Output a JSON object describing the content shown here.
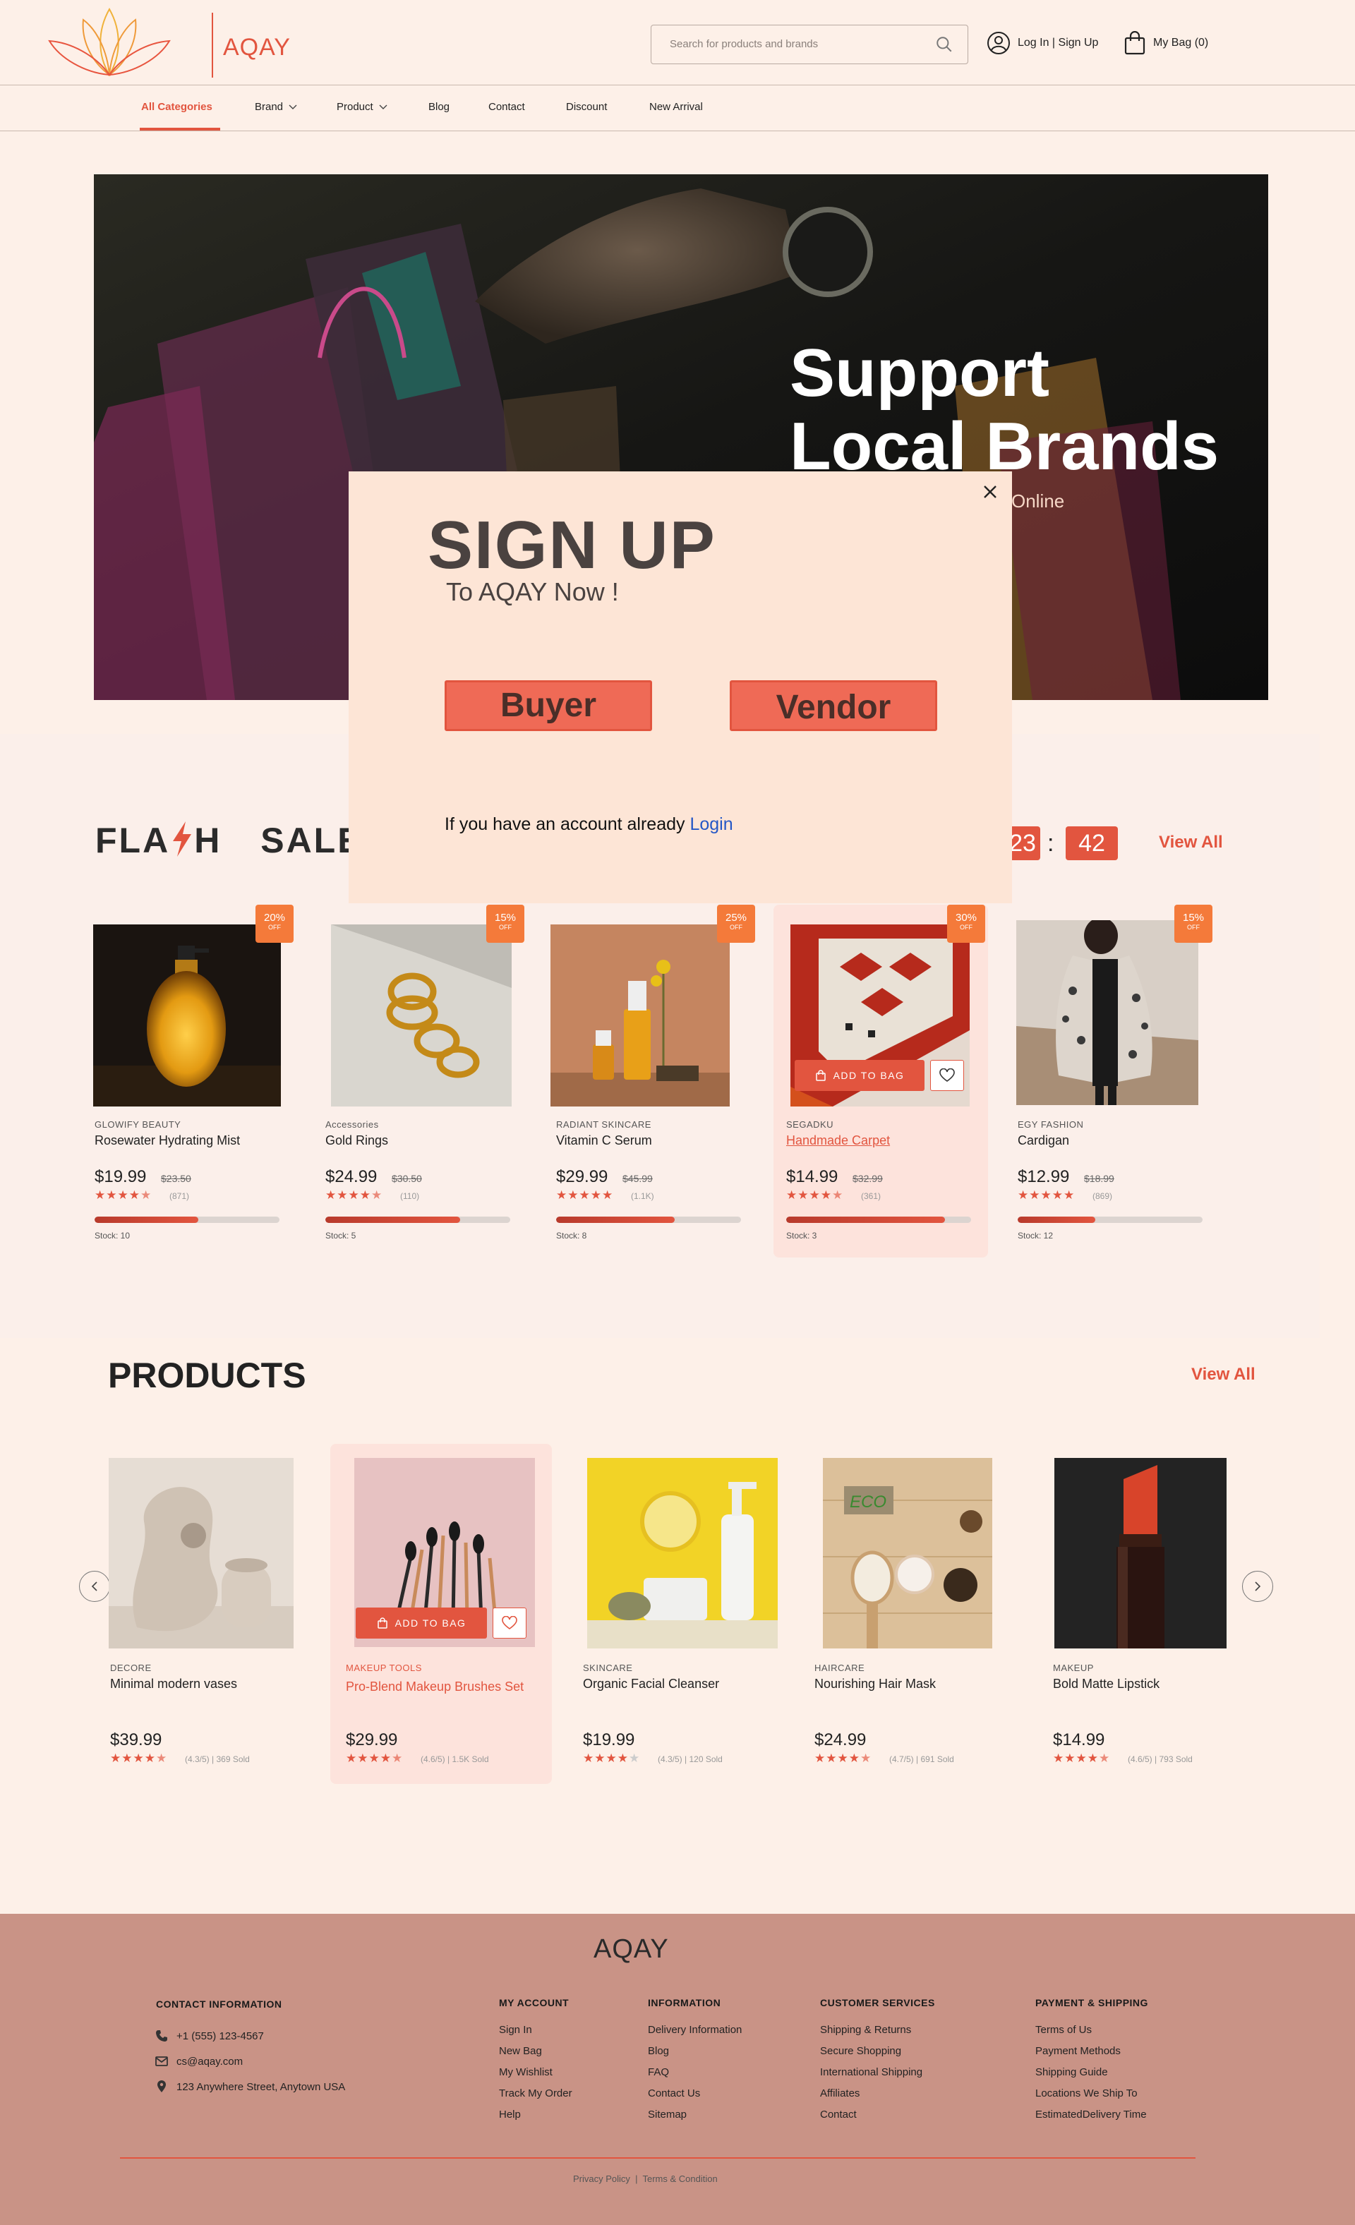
{
  "brand": {
    "name": "AQAY",
    "accent": "#e2553f"
  },
  "header": {
    "search_placeholder": "Search for products and brands",
    "login_label": "Log In | Sign Up",
    "bag_label": "My Bag (0)"
  },
  "nav": {
    "items": [
      {
        "label": "All Categories",
        "active": true
      },
      {
        "label": "Brand",
        "dropdown": true
      },
      {
        "label": "Product",
        "dropdown": true
      },
      {
        "label": "Blog"
      },
      {
        "label": "Contact"
      },
      {
        "label": "Discount"
      },
      {
        "label": "New Arrival"
      }
    ]
  },
  "hero": {
    "title_line1": "Support",
    "title_line2": "Local Brands",
    "subtitle": "Online"
  },
  "modal": {
    "title": "SIGN UP",
    "subtitle": "To AQAY Now !",
    "buyer_label": "Buyer",
    "vendor_label": "Vendor",
    "login_prompt": "If you have an account already",
    "login_link": "Login"
  },
  "flash": {
    "title_part1": "FLA",
    "title_part2": "H",
    "title_part3": "SALE",
    "countdown": [
      "23",
      "42"
    ],
    "view_all": "View All",
    "add_to_bag": "ADD TO BAG",
    "products": [
      {
        "badge": "20%",
        "off": "OFF",
        "brand": "GLOWIFY BEAUTY",
        "name": "Rosewater Hydrating Mist",
        "price": "$19.99",
        "old_price": "$23.50",
        "rating_count": "(871)",
        "stars": 4.5,
        "stock_label": "Stock: 10",
        "stock_fraction": 0.56
      },
      {
        "badge": "15%",
        "off": "OFF",
        "brand": "Accessories",
        "name": "Gold Rings",
        "price": "$24.99",
        "old_price": "$30.50",
        "rating_count": "(110)",
        "stars": 4.5,
        "stock_label": "Stock: 5",
        "stock_fraction": 0.73
      },
      {
        "badge": "25%",
        "off": "OFF",
        "brand": "RADIANT SKINCARE",
        "name": "Vitamin C Serum",
        "price": "$29.99",
        "old_price": "$45.99",
        "rating_count": "(1.1K)",
        "stars": 5,
        "stock_label": "Stock: 8",
        "stock_fraction": 0.64
      },
      {
        "badge": "30%",
        "off": "OFF",
        "brand": "SEGADKU",
        "name": "Handmade Carpet",
        "price": "$14.99",
        "old_price": "$32.99",
        "rating_count": "(361)",
        "stars": 4.5,
        "stock_label": "Stock: 3",
        "stock_fraction": 0.86
      },
      {
        "badge": "15%",
        "off": "OFF",
        "brand": "EGY FASHION",
        "name": "Cardigan",
        "price": "$12.99",
        "old_price": "$18.99",
        "rating_count": "(869)",
        "stars": 5,
        "stock_label": "Stock: 12",
        "stock_fraction": 0.42
      }
    ]
  },
  "products": {
    "title": "PRODUCTS",
    "view_all": "View All",
    "add_to_bag": "ADD TO BAG",
    "items": [
      {
        "category": "DECORE",
        "name": "Minimal modern vases",
        "price": "$39.99",
        "rating": "(4.3/5) | 369 Sold",
        "stars": 4.5
      },
      {
        "category": "MAKEUP TOOLS",
        "name": "Pro-Blend Makeup Brushes Set",
        "price": "$29.99",
        "rating": "(4.6/5) | 1.5K Sold",
        "stars": 4.5
      },
      {
        "category": "SKINCARE",
        "name": "Organic Facial Cleanser",
        "price": "$19.99",
        "rating": "(4.3/5) | 120 Sold",
        "stars": 4
      },
      {
        "category": "HAIRCARE",
        "name": "Nourishing Hair Mask",
        "price": "$24.99",
        "rating": "(4.7/5) | 691 Sold",
        "stars": 4.5
      },
      {
        "category": "MAKEUP",
        "name": "Bold Matte Lipstick",
        "price": "$14.99",
        "rating": "(4.6/5) | 793 Sold",
        "stars": 4.5
      }
    ]
  },
  "footer": {
    "logo": "AQAY",
    "contact_title": "CONTACT INFORMATION",
    "phone": "+1 (555) 123-4567",
    "email": "cs@aqay.com",
    "address": "123 Anywhere Street, Anytown USA",
    "columns": [
      {
        "title": "MY ACCOUNT",
        "links": [
          "Sign In",
          "New Bag",
          "My Wishlist",
          "Track My Order",
          "Help"
        ]
      },
      {
        "title": "INFORMATION",
        "links": [
          "Delivery Information",
          "Blog",
          "FAQ",
          "Contact Us",
          "Sitemap"
        ]
      },
      {
        "title": "CUSTOMER SERVICES",
        "links": [
          "Shipping & Returns",
          "Secure Shopping",
          "International Shipping",
          "Affiliates",
          "Contact"
        ]
      },
      {
        "title": "PAYMENT & SHIPPING",
        "links": [
          "Terms of Us",
          "Payment Methods",
          "Shipping Guide",
          "Locations We Ship To",
          "EstimatedDelivery Time"
        ]
      }
    ],
    "legal": "Privacy Policy  |  Terms & Condition"
  }
}
